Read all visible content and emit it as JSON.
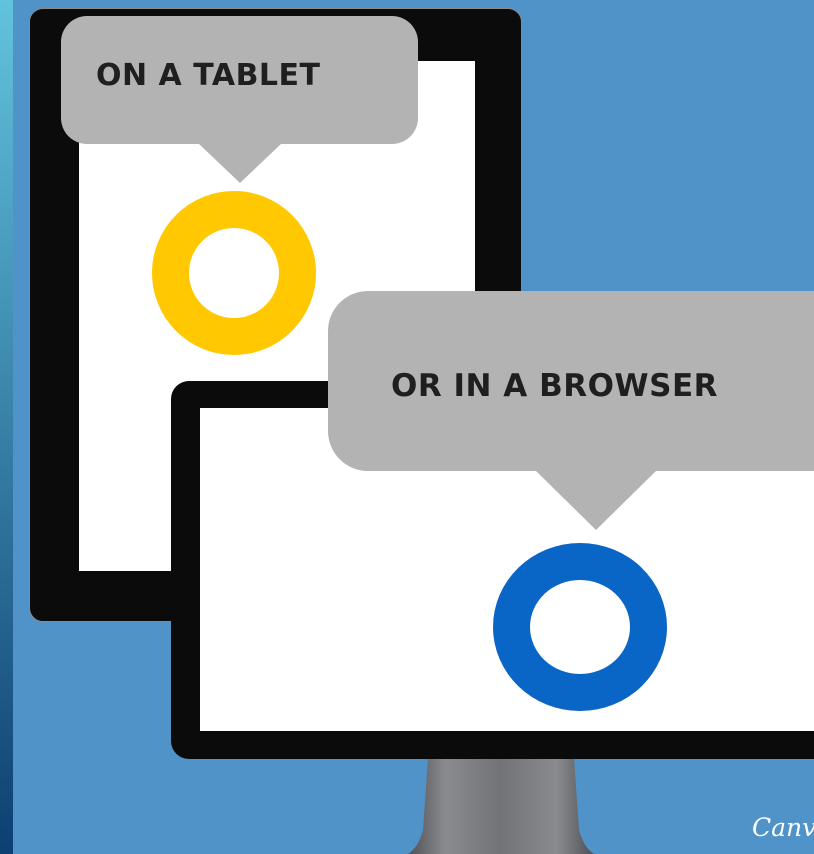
{
  "labels": {
    "tablet": "ON A TABLET",
    "browser": "OR IN A BROWSER"
  },
  "watermark": {
    "text": "Canva"
  },
  "icons": {
    "tablet_ring": "yellow-ring-icon",
    "browser_ring": "blue-ring-icon"
  },
  "colors": {
    "background": "#4f93c9",
    "left_strip_top": "#62c3dc",
    "left_strip_bottom": "#0d3f72",
    "device_frame": "#0b0b0b",
    "screen": "#ffffff",
    "bubble": "#b3b3b3",
    "text": "#1f1f1f",
    "tablet_ring": "#ffc800",
    "browser_ring": "#0a66c6",
    "stand": "#7b7c80",
    "watermark": "#ffffff"
  }
}
